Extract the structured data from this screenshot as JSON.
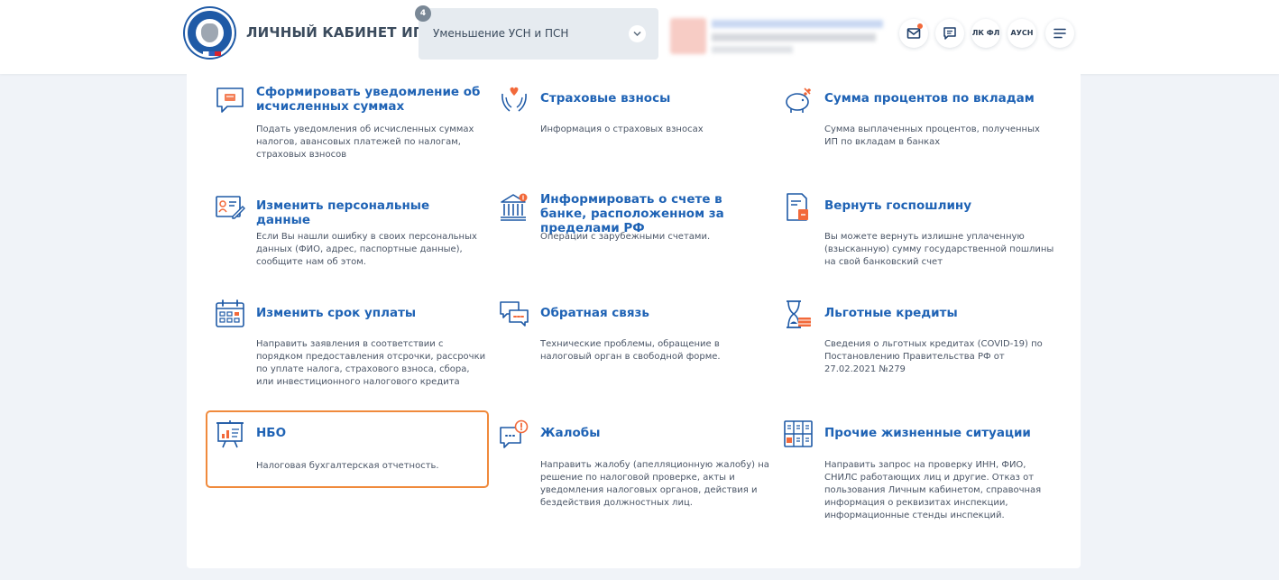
{
  "header": {
    "app_title": "ЛИЧНЫЙ КАБИНЕТ ИП",
    "dropdown": {
      "badge": "4",
      "selected": "Уменьшение УСН и ПСН"
    },
    "buttons": {
      "lkfl": "ЛК ФЛ",
      "ausn": "АУСН"
    }
  },
  "colors": {
    "accent": "#1f63b5",
    "highlight": "#f08a3c",
    "icon_orange": "#f2693a"
  },
  "cards": [
    {
      "title": "Сформировать уведомление об исчисленных суммах",
      "desc": "Подать уведомления об исчисленных суммах налогов, авансовых платежей по налогам, страховых взносов",
      "icon": "notification-icon"
    },
    {
      "title": "Страховые взносы",
      "desc": "Информация о страховых взносах",
      "icon": "insurance-hands-icon"
    },
    {
      "title": "Сумма процентов по вкладам",
      "desc": "Сумма выплаченных процентов, полученных ИП по вкладам в банках",
      "icon": "piggy-bank-icon"
    },
    {
      "title": "Изменить персональные данные",
      "desc": "Если Вы нашли ошибку в своих персональных данных (ФИО, адрес, паспортные данные), сообщите нам об этом.",
      "icon": "id-card-edit-icon"
    },
    {
      "title": "Информировать о счете в банке, расположенном за пределами РФ",
      "desc": "Операции с зарубежными счетами.",
      "icon": "bank-icon"
    },
    {
      "title": "Вернуть госпошлину",
      "desc": "Вы можете вернуть излишне уплаченную (взысканную) сумму государственной пошлины на свой банковский счет",
      "icon": "document-refund-icon"
    },
    {
      "title": "Изменить срок уплаты",
      "desc": "Направить заявления в соответствии с порядком предоставления отсрочки, рассрочки по уплате налога, страхового взноса, сбора, или инвестиционного налогового кредита",
      "icon": "calendar-icon"
    },
    {
      "title": "Обратная связь",
      "desc": "Технические проблемы, обращение в налоговый орган в свободной форме.",
      "icon": "chat-bubbles-icon"
    },
    {
      "title": "Льготные кредиты",
      "desc": "Сведения о льготных кредитах (COVID-19) по Постановлению Правительства РФ от 27.02.2021 №279",
      "icon": "hourglass-money-icon"
    },
    {
      "title": "НБО",
      "desc": "Налоговая бухгалтерская отчетность.",
      "icon": "presentation-chart-icon"
    },
    {
      "title": "Жалобы",
      "desc": "Направить жалобу (апелляционную жалобу) на решение по налоговой проверке, акты и уведомления налоговых органов, действия и бездействия должностных лиц.",
      "icon": "complaint-bubble-icon"
    },
    {
      "title": "Прочие жизненные ситуации",
      "desc": "Направить запрос на проверку ИНН, ФИО, СНИЛС работающих лиц и другие. Отказ от пользования Личным кабинетом, справочная информация о реквизитах инспекции, информационные стенды инспекций.",
      "icon": "grid-list-icon"
    }
  ]
}
